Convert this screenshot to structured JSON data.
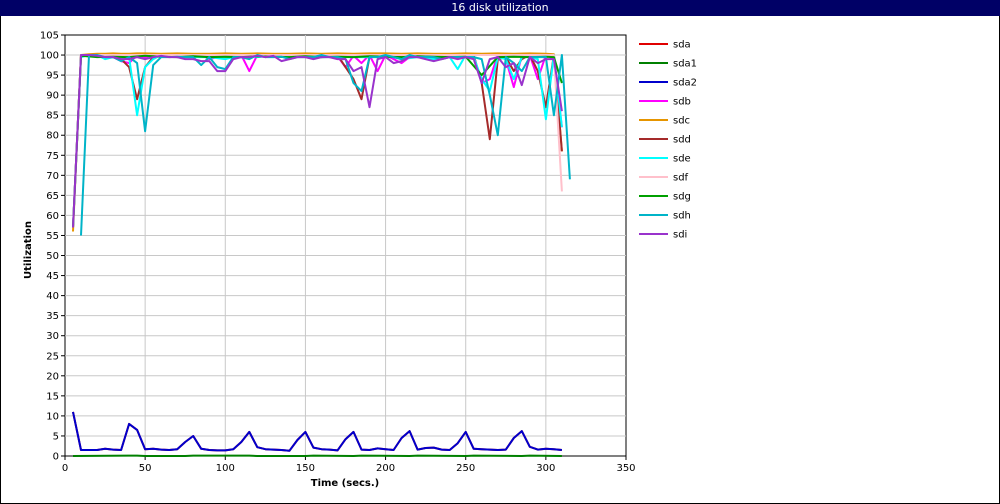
{
  "window": {
    "title": "16 disk utilization"
  },
  "chart_data": {
    "type": "line",
    "title": "16 disk utilization",
    "xlabel": "Time (secs.)",
    "ylabel": "Utilization",
    "xlim": [
      0,
      350
    ],
    "ylim": [
      0,
      105
    ],
    "xticks": [
      0,
      50,
      100,
      150,
      200,
      250,
      300,
      350
    ],
    "yticks": [
      0,
      5,
      10,
      15,
      20,
      25,
      30,
      35,
      40,
      45,
      50,
      55,
      60,
      65,
      70,
      75,
      80,
      85,
      90,
      95,
      100,
      105
    ],
    "grid": true,
    "legend": "right",
    "series": [
      {
        "name": "sda",
        "color": "#e00000",
        "x": [
          5,
          10,
          15,
          20,
          25,
          30,
          35,
          40,
          45,
          50,
          55,
          60,
          65,
          70,
          75,
          80,
          85,
          90,
          95,
          100,
          105,
          110,
          115,
          120,
          125,
          130,
          135,
          140,
          145,
          150,
          155,
          160,
          165,
          170,
          175,
          180,
          185,
          190,
          195,
          200,
          205,
          210,
          215,
          220,
          225,
          230,
          235,
          240,
          245,
          250,
          255,
          260,
          265,
          270,
          275,
          280,
          285,
          290,
          295,
          300,
          305,
          310
        ],
        "y": [
          11,
          1.5,
          1.5,
          1.5,
          1.8,
          1.6,
          1.5,
          8,
          6.5,
          1.7,
          1.8,
          1.6,
          1.5,
          1.7,
          3.5,
          5,
          1.8,
          1.5,
          1.4,
          1.4,
          1.7,
          3.5,
          6,
          2.2,
          1.7,
          1.6,
          1.5,
          1.3,
          4,
          6,
          2.1,
          1.7,
          1.6,
          1.4,
          4.2,
          6,
          1.6,
          1.5,
          1.9,
          1.7,
          1.5,
          4.5,
          6.2,
          1.6,
          2.0,
          2.1,
          1.6,
          1.5,
          3.2,
          6,
          1.8,
          1.7,
          1.6,
          1.5,
          1.6,
          4.5,
          6.2,
          2.3,
          1.6,
          1.8,
          1.7,
          1.5
        ]
      },
      {
        "name": "sda1",
        "color": "#008000",
        "x": [
          5,
          40,
          45,
          50,
          75,
          80,
          115,
          120,
          150,
          155,
          180,
          185,
          215,
          220,
          250,
          255,
          285,
          290,
          310
        ],
        "y": [
          0,
          0.1,
          0.1,
          0,
          0,
          0.1,
          0.1,
          0,
          0,
          0.1,
          0,
          0.1,
          0,
          0.1,
          0,
          0.1,
          0,
          0.1,
          0
        ]
      },
      {
        "name": "sda2",
        "color": "#0000cc",
        "x": [
          5,
          10,
          15,
          20,
          25,
          30,
          35,
          40,
          45,
          50,
          55,
          60,
          65,
          70,
          75,
          80,
          85,
          90,
          95,
          100,
          105,
          110,
          115,
          120,
          125,
          130,
          135,
          140,
          145,
          150,
          155,
          160,
          165,
          170,
          175,
          180,
          185,
          190,
          195,
          200,
          205,
          210,
          215,
          220,
          225,
          230,
          235,
          240,
          245,
          250,
          255,
          260,
          265,
          270,
          275,
          280,
          285,
          290,
          295,
          300,
          305,
          310
        ],
        "y": [
          11,
          1.5,
          1.5,
          1.5,
          1.8,
          1.6,
          1.5,
          8,
          6.5,
          1.7,
          1.8,
          1.6,
          1.5,
          1.7,
          3.5,
          5,
          1.8,
          1.5,
          1.4,
          1.4,
          1.7,
          3.5,
          6,
          2.2,
          1.7,
          1.6,
          1.5,
          1.3,
          4,
          6,
          2.1,
          1.7,
          1.6,
          1.4,
          4.2,
          6,
          1.6,
          1.5,
          1.9,
          1.7,
          1.5,
          4.5,
          6.2,
          1.6,
          2.0,
          2.1,
          1.6,
          1.5,
          3.2,
          6,
          1.8,
          1.7,
          1.6,
          1.5,
          1.6,
          4.5,
          6.2,
          2.3,
          1.6,
          1.8,
          1.7,
          1.5
        ]
      },
      {
        "name": "sdb",
        "color": "#ff00ff",
        "x": [
          5,
          10,
          15,
          20,
          25,
          30,
          35,
          40,
          45,
          50,
          55,
          60,
          65,
          70,
          75,
          80,
          85,
          90,
          95,
          100,
          105,
          110,
          115,
          120,
          125,
          130,
          135,
          140,
          145,
          150,
          155,
          160,
          165,
          170,
          175,
          180,
          185,
          190,
          195,
          200,
          205,
          210,
          215,
          220,
          225,
          230,
          235,
          240,
          245,
          250,
          255,
          260,
          265,
          270,
          275,
          280,
          285,
          290,
          295,
          300,
          305,
          310
        ],
        "y": [
          57,
          100,
          100,
          100,
          100,
          99.5,
          98.5,
          98,
          100,
          99.5,
          100,
          100,
          99.8,
          100,
          99.5,
          99.6,
          100,
          99,
          99.5,
          100,
          99.5,
          100,
          96,
          100,
          99.8,
          99.7,
          100,
          99.5,
          99.8,
          100,
          99.5,
          100,
          100,
          99.7,
          97,
          99.8,
          98,
          100,
          96,
          100,
          99,
          98,
          99.5,
          100,
          99.6,
          99.2,
          100,
          99.5,
          99.8,
          100,
          99.5,
          93,
          94,
          100,
          99,
          92,
          99.8,
          100,
          94,
          100,
          99,
          82
        ]
      },
      {
        "name": "sdc",
        "color": "#e69500",
        "x": [
          5,
          10,
          15,
          20,
          25,
          30,
          35,
          40,
          45,
          50,
          60,
          70,
          80,
          90,
          100,
          110,
          120,
          130,
          140,
          150,
          160,
          170,
          180,
          190,
          200,
          210,
          220,
          230,
          240,
          250,
          260,
          270,
          280,
          290,
          300,
          305,
          310
        ],
        "y": [
          56,
          100,
          100.2,
          100.3,
          100.3,
          100.4,
          100.3,
          100.3,
          100.4,
          100.4,
          100.3,
          100.4,
          100.3,
          100.3,
          100.4,
          100.3,
          100.4,
          100.3,
          100.3,
          100.4,
          100.3,
          100.4,
          100.3,
          100.4,
          100.4,
          100.3,
          100.4,
          100.3,
          100.3,
          100.4,
          100.3,
          100.4,
          100.3,
          100.4,
          100.3,
          100.2,
          76
        ]
      },
      {
        "name": "sdd",
        "color": "#a52a2a",
        "x": [
          5,
          10,
          15,
          20,
          25,
          30,
          35,
          40,
          45,
          50,
          55,
          60,
          70,
          80,
          90,
          100,
          110,
          120,
          130,
          140,
          150,
          160,
          170,
          175,
          180,
          185,
          190,
          195,
          200,
          210,
          220,
          230,
          240,
          250,
          255,
          260,
          265,
          270,
          275,
          280,
          285,
          290,
          295,
          300,
          305,
          310
        ],
        "y": [
          57,
          100,
          100,
          100,
          99.5,
          99.5,
          99,
          97,
          89,
          97,
          99.5,
          100,
          100,
          99.8,
          99.5,
          100,
          99.5,
          100,
          100,
          99.8,
          100,
          99.5,
          100,
          97,
          94,
          89,
          99.5,
          100,
          100,
          99.5,
          100,
          99.8,
          100,
          99.5,
          100,
          93,
          79,
          99,
          99.5,
          96,
          99,
          100,
          96,
          87,
          100,
          76
        ]
      },
      {
        "name": "sde",
        "color": "#00ffff",
        "x": [
          5,
          10,
          15,
          20,
          25,
          30,
          35,
          40,
          45,
          50,
          55,
          60,
          70,
          80,
          90,
          100,
          110,
          120,
          130,
          140,
          150,
          160,
          170,
          180,
          190,
          200,
          210,
          220,
          230,
          240,
          245,
          250,
          255,
          260,
          265,
          270,
          275,
          280,
          285,
          290,
          295,
          300,
          305,
          310
        ],
        "y": [
          57,
          99.5,
          100,
          100,
          99,
          99.5,
          99,
          99.5,
          85,
          97,
          99,
          100,
          99.5,
          99.5,
          99.5,
          99,
          100,
          99.5,
          99.8,
          99.5,
          100,
          99.5,
          99.5,
          99.5,
          99.5,
          100,
          99,
          99.5,
          99,
          99.5,
          96.5,
          100,
          99.5,
          94,
          91,
          99.5,
          99,
          94,
          99.5,
          99.5,
          99,
          84,
          100,
          82
        ]
      },
      {
        "name": "sdf",
        "color": "#ffc0cb",
        "x": [
          5,
          10,
          20,
          30,
          40,
          50,
          60,
          70,
          80,
          90,
          100,
          110,
          120,
          130,
          140,
          150,
          160,
          170,
          180,
          190,
          200,
          210,
          220,
          230,
          240,
          250,
          260,
          270,
          280,
          290,
          300,
          305,
          310
        ],
        "y": [
          57,
          100,
          100,
          100,
          100,
          100,
          100,
          100,
          100,
          100,
          100,
          100,
          100,
          100,
          100,
          100,
          100,
          100,
          100,
          100,
          100,
          100,
          100,
          100,
          100,
          100,
          100,
          100,
          100,
          100,
          100,
          100,
          66
        ]
      },
      {
        "name": "sdg",
        "color": "#00a000",
        "x": [
          5,
          10,
          20,
          30,
          40,
          50,
          60,
          70,
          80,
          90,
          100,
          110,
          120,
          130,
          140,
          150,
          160,
          170,
          180,
          190,
          200,
          210,
          220,
          230,
          240,
          250,
          260,
          270,
          280,
          290,
          300,
          305,
          310
        ],
        "y": [
          57,
          99.8,
          99.5,
          99.6,
          99.5,
          99.8,
          99.6,
          99.5,
          99.7,
          99.5,
          99.6,
          99.5,
          99.7,
          99.6,
          99.5,
          99.7,
          99.5,
          99.6,
          99.5,
          99.7,
          99.6,
          99.5,
          99.7,
          99.6,
          99.5,
          99.6,
          95,
          99.5,
          99.6,
          99.5,
          99.6,
          99.5,
          93
        ]
      },
      {
        "name": "sdh",
        "color": "#00b4c8",
        "x": [
          10,
          15,
          20,
          25,
          30,
          35,
          40,
          45,
          50,
          55,
          60,
          65,
          70,
          75,
          80,
          85,
          90,
          95,
          100,
          105,
          110,
          115,
          120,
          125,
          130,
          135,
          140,
          145,
          150,
          155,
          160,
          165,
          170,
          175,
          180,
          185,
          190,
          195,
          200,
          205,
          210,
          215,
          220,
          225,
          230,
          235,
          240,
          245,
          250,
          255,
          260,
          265,
          270,
          275,
          280,
          285,
          290,
          295,
          300,
          305,
          310,
          315
        ],
        "y": [
          55,
          100,
          100,
          99.5,
          99.5,
          98.5,
          99.5,
          98,
          81,
          97.5,
          99.5,
          99.5,
          99.6,
          99.5,
          99.5,
          97.5,
          99.5,
          97,
          96.5,
          99.5,
          99.5,
          99,
          100,
          99.5,
          99.5,
          99.6,
          99,
          99.5,
          99.5,
          99.5,
          100,
          99.5,
          99.5,
          99,
          93,
          91,
          99.5,
          99.5,
          100,
          99.5,
          99,
          100,
          99.5,
          99.6,
          99.5,
          99,
          99.5,
          99.5,
          99.5,
          99.5,
          99,
          90,
          80,
          99.5,
          98,
          96,
          99.5,
          99.5,
          99.5,
          85,
          100,
          69
        ]
      },
      {
        "name": "sdi",
        "color": "#9933cc",
        "x": [
          5,
          10,
          15,
          20,
          25,
          30,
          35,
          40,
          45,
          50,
          55,
          60,
          65,
          70,
          75,
          80,
          85,
          90,
          95,
          100,
          105,
          110,
          115,
          120,
          125,
          130,
          135,
          140,
          145,
          150,
          155,
          160,
          165,
          170,
          175,
          180,
          185,
          190,
          195,
          200,
          205,
          210,
          215,
          220,
          225,
          230,
          235,
          240,
          245,
          250,
          255,
          260,
          265,
          270,
          275,
          280,
          285,
          290,
          295,
          300,
          305,
          310
        ],
        "y": [
          57,
          100,
          100,
          99.8,
          99.5,
          99.5,
          99,
          99,
          99.5,
          99,
          99.5,
          99.8,
          99.5,
          99.5,
          99,
          99,
          98.5,
          98.5,
          96,
          96,
          99,
          99.5,
          99.5,
          99.8,
          99.5,
          99.8,
          98.5,
          99,
          99.5,
          99.5,
          99,
          99.5,
          99.5,
          99,
          99,
          96,
          97,
          87,
          99,
          99.5,
          98,
          98.5,
          99.5,
          99.5,
          99,
          98.5,
          99,
          99.5,
          99,
          99.5,
          99,
          93,
          99,
          99.5,
          97,
          98,
          92.5,
          99.5,
          98,
          99,
          99,
          86
        ]
      }
    ]
  }
}
